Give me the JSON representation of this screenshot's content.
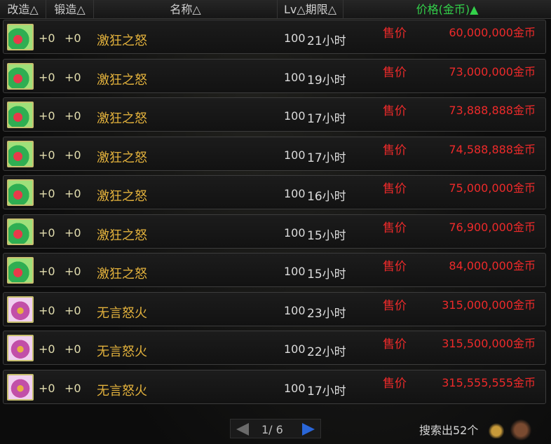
{
  "header": {
    "upgrade": "改造△",
    "forge": "锻造△",
    "name": "名称△",
    "lv_period": "Lv△期限△",
    "price": "价格(金币)▲"
  },
  "sale_label": "售价",
  "rows": [
    {
      "upgrade": "+0",
      "forge": "+0",
      "name": "激狂之怒",
      "lv": "100",
      "period": "21小时",
      "price": "60,000,000金币",
      "icon": "jikuang-item-icon"
    },
    {
      "upgrade": "+0",
      "forge": "+0",
      "name": "激狂之怒",
      "lv": "100",
      "period": "19小时",
      "price": "73,000,000金币",
      "icon": "jikuang-item-icon"
    },
    {
      "upgrade": "+0",
      "forge": "+0",
      "name": "激狂之怒",
      "lv": "100",
      "period": "17小时",
      "price": "73,888,888金币",
      "icon": "jikuang-item-icon"
    },
    {
      "upgrade": "+0",
      "forge": "+0",
      "name": "激狂之怒",
      "lv": "100",
      "period": "17小时",
      "price": "74,588,888金币",
      "icon": "jikuang-item-icon"
    },
    {
      "upgrade": "+0",
      "forge": "+0",
      "name": "激狂之怒",
      "lv": "100",
      "period": "16小时",
      "price": "75,000,000金币",
      "icon": "jikuang-item-icon"
    },
    {
      "upgrade": "+0",
      "forge": "+0",
      "name": "激狂之怒",
      "lv": "100",
      "period": "15小时",
      "price": "76,900,000金币",
      "icon": "jikuang-item-icon"
    },
    {
      "upgrade": "+0",
      "forge": "+0",
      "name": "激狂之怒",
      "lv": "100",
      "period": "15小时",
      "price": "84,000,000金币",
      "icon": "jikuang-item-icon"
    },
    {
      "upgrade": "+0",
      "forge": "+0",
      "name": "无言怒火",
      "lv": "100",
      "period": "23小时",
      "price": "315,000,000金币",
      "icon": "wuyan-item-icon"
    },
    {
      "upgrade": "+0",
      "forge": "+0",
      "name": "无言怒火",
      "lv": "100",
      "period": "22小时",
      "price": "315,500,000金币",
      "icon": "wuyan-item-icon"
    },
    {
      "upgrade": "+0",
      "forge": "+0",
      "name": "无言怒火",
      "lv": "100",
      "period": "17小时",
      "price": "315,555,555金币",
      "icon": "wuyan-item-icon"
    }
  ],
  "pagination": {
    "text": "1/ 6"
  },
  "total": "搜索出52个",
  "colors": {
    "price_red": "#ee2a2a",
    "name_gold": "#e2b13c",
    "active_header_green": "#33d14a",
    "next_arrow_blue": "#2a66d8"
  }
}
